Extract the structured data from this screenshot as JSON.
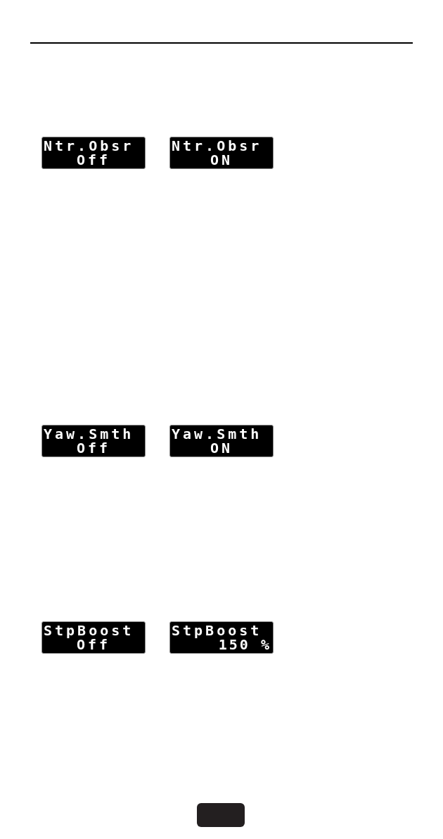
{
  "sections": [
    {
      "displays": [
        {
          "name": "Ntr.Obsr",
          "value": "Off"
        },
        {
          "name": "Ntr.Obsr",
          "value": "ON"
        }
      ]
    },
    {
      "displays": [
        {
          "name": "Yaw.Smth",
          "value": "Off"
        },
        {
          "name": "Yaw.Smth",
          "value": "ON"
        }
      ]
    },
    {
      "displays": [
        {
          "name": "StpBoost",
          "value": "Off"
        },
        {
          "name": "StpBoost",
          "value": "150 %"
        }
      ]
    }
  ]
}
